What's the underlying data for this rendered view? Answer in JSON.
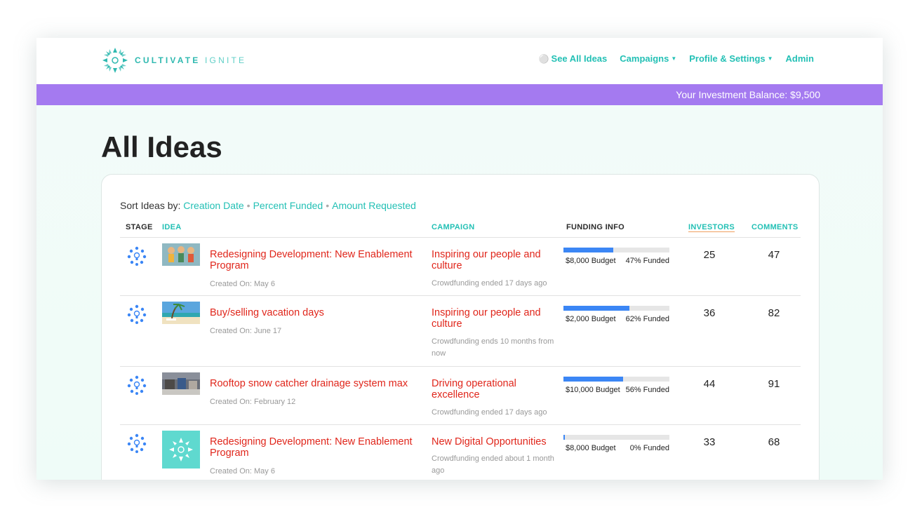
{
  "brand": {
    "name_bold": "CULTIVATE",
    "name_light": "IGNITE",
    "logo_icon": "cultivate-logo-icon"
  },
  "nav": {
    "items": [
      {
        "label": "See All Ideas",
        "icon": "lightbulb-icon"
      },
      {
        "label": "Campaigns",
        "icon": "caret-down-icon"
      },
      {
        "label": "Profile & Settings",
        "icon": "caret-down-icon"
      },
      {
        "label": "Admin"
      }
    ]
  },
  "balance": {
    "text": "Your Investment Balance: $9,500"
  },
  "page": {
    "title": "All Ideas"
  },
  "sort": {
    "label": "Sort Ideas by:",
    "options": [
      "Creation Date",
      "Percent Funded",
      "Amount Requested"
    ]
  },
  "table": {
    "headers": [
      "STAGE",
      "IDEA",
      "CAMPAIGN",
      "FUNDING INFO",
      "INVESTORS",
      "COMMENTS"
    ],
    "rows": [
      {
        "idea": "Redesigning Development: New Enablement Program",
        "created": "Created On: May 6",
        "campaign": "Inspiring our people and culture",
        "campaign_status": "Crowdfunding ended 17 days ago",
        "budget": "$8,000 Budget",
        "funded": "47% Funded",
        "funded_pct": 47,
        "investors": "25",
        "comments": "47"
      },
      {
        "idea": "Buy/selling vacation days",
        "created": "Created On: June 17",
        "campaign": "Inspiring our people and culture",
        "campaign_status": "Crowdfunding ends 10 months from now",
        "budget": "$2,000 Budget",
        "funded": "62% Funded",
        "funded_pct": 62,
        "investors": "36",
        "comments": "82"
      },
      {
        "idea": "Rooftop snow catcher drainage system max",
        "created": "Created On: February 12",
        "campaign": "Driving operational excellence",
        "campaign_status": "Crowdfunding ended 17 days ago",
        "budget": "$10,000 Budget",
        "funded": "56% Funded",
        "funded_pct": 56,
        "investors": "44",
        "comments": "91"
      },
      {
        "idea": "Redesigning Development: New Enablement Program",
        "created": "Created On: May 6",
        "campaign": "New Digital Opportunities",
        "campaign_status": "Crowdfunding ended about 1 month ago",
        "budget": "$8,000 Budget",
        "funded": "0% Funded",
        "funded_pct": 0,
        "investors": "33",
        "comments": "68"
      }
    ]
  },
  "colors": {
    "accent": "#23c0b5",
    "banner": "#a47af0",
    "idea_link": "#e0261b",
    "progress": "#3b86f5"
  }
}
